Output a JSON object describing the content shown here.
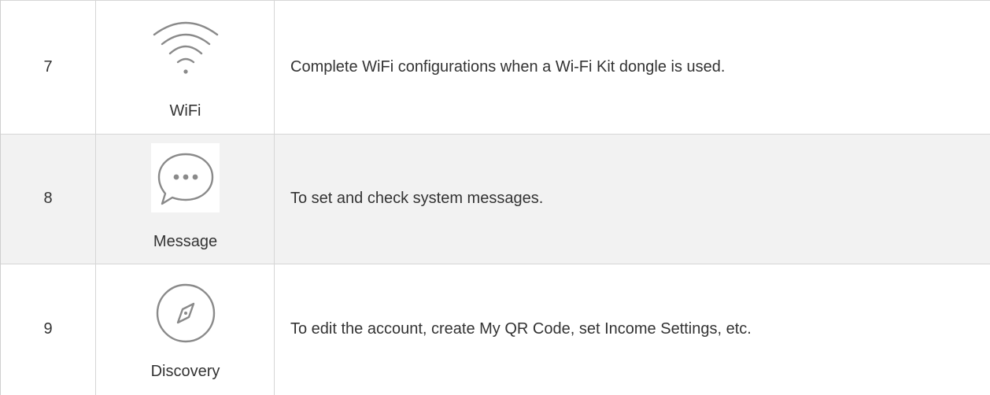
{
  "rows": [
    {
      "number": "7",
      "icon": "wifi-icon",
      "label": "WiFi",
      "description": "Complete WiFi configurations when a Wi-Fi Kit dongle is used."
    },
    {
      "number": "8",
      "icon": "chat-bubble-icon",
      "label": "Message",
      "description": "To set and check system messages."
    },
    {
      "number": "9",
      "icon": "compass-icon",
      "label": "Discovery",
      "description": "To edit the account, create My QR Code, set Income Settings, etc."
    }
  ],
  "colors": {
    "grid_line": "#d6d6d6",
    "alt_row_bg": "#f2f2f2",
    "text": "#333333",
    "icon_stroke": "#8a8a8a"
  }
}
